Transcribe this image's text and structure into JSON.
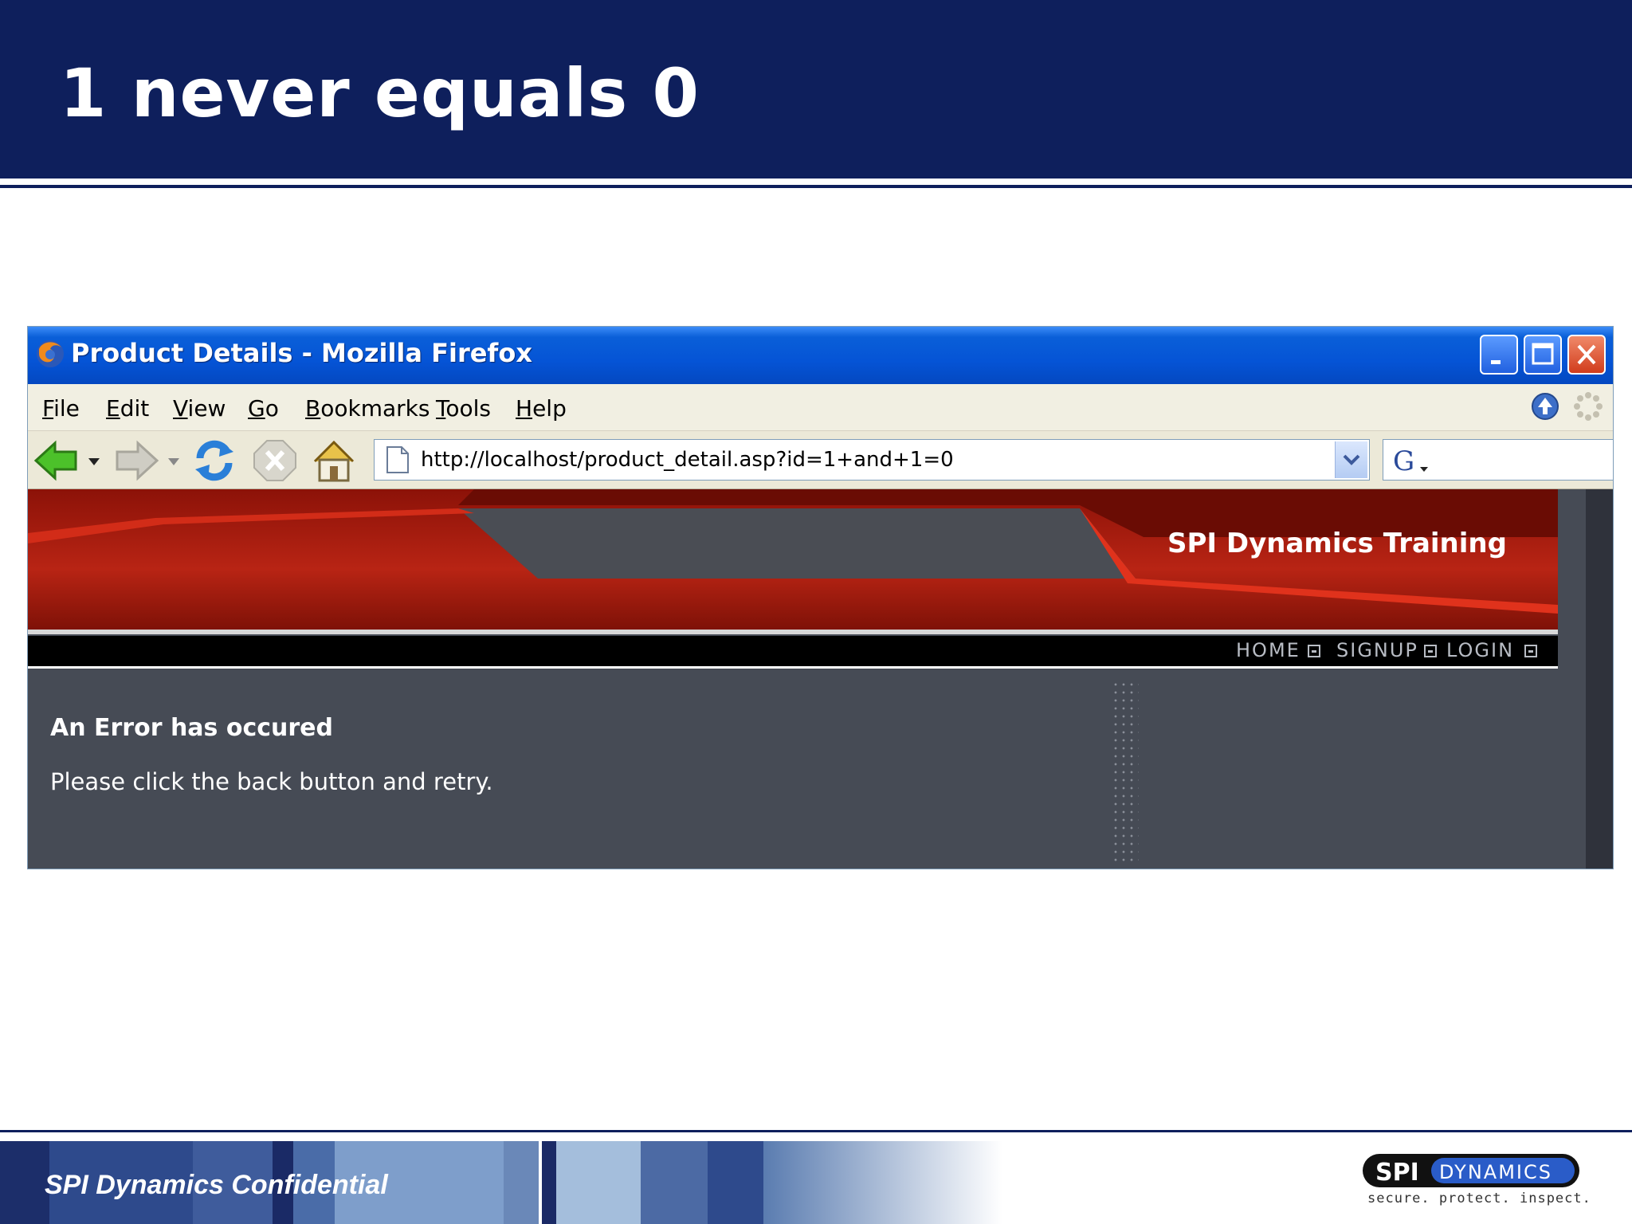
{
  "slide": {
    "title": "1 never equals 0",
    "footer_text": "SPI Dynamics Confidential",
    "logo": {
      "word_left": "SPI",
      "word_right": "DYNAMICS",
      "tagline": "secure. protect. inspect."
    }
  },
  "browser": {
    "window_title": "Product Details - Mozilla Firefox",
    "menu": [
      "File",
      "Edit",
      "View",
      "Go",
      "Bookmarks",
      "Tools",
      "Help"
    ],
    "url": "http://localhost/product_detail.asp?id=1+and+1=0",
    "search_value": ""
  },
  "site": {
    "brand": "SPI Dynamics Training",
    "nav": [
      "HOME",
      "SIGNUP",
      "LOGIN"
    ],
    "error_heading": "An Error has occured",
    "error_message": "Please click the back button and retry."
  },
  "colors": {
    "slide_navy": "#0e1f5c",
    "xp_titlebar_blue": "#0554d6",
    "banner_red": "#b01e10",
    "page_slate": "#464b55"
  },
  "icons": {
    "toolbar": [
      "back-arrow-icon",
      "forward-arrow-icon",
      "reload-icon",
      "stop-icon",
      "home-icon"
    ],
    "window": [
      "firefox-icon",
      "minimize-icon",
      "maximize-icon",
      "close-icon"
    ]
  }
}
